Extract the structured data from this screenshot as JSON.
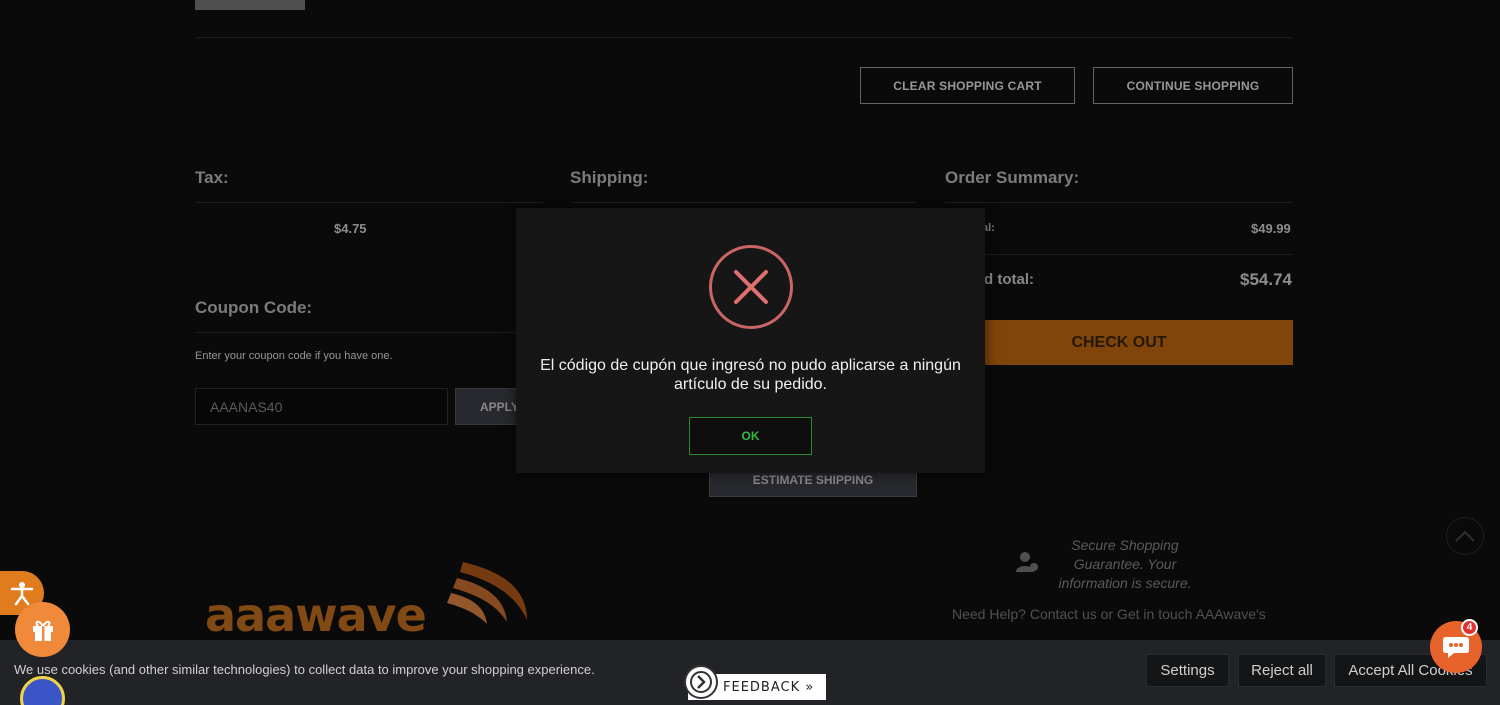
{
  "cart_actions": {
    "clear_label": "CLEAR SHOPPING CART",
    "continue_label": "CONTINUE SHOPPING"
  },
  "tax": {
    "title": "Tax:",
    "value": "$4.75"
  },
  "shipping": {
    "title": "Shipping:",
    "estimate_label": "ESTIMATE SHIPPING"
  },
  "order_summary": {
    "title": "Order Summary:",
    "subtotal_label": "al:",
    "subtotal_value": "$49.99",
    "grand_total_label": "d total:",
    "grand_total_value": "$54.74",
    "checkout_label": "CHECK OUT"
  },
  "coupon": {
    "title": "Coupon Code:",
    "hint": "Enter your coupon code if you have one.",
    "value": "AAANAS40",
    "apply_label": "APPLY"
  },
  "modal": {
    "message": "El código de cupón que ingresó no pudo aplicarse a ningún artículo de su pedido.",
    "ok_label": "OK"
  },
  "footer": {
    "brand": "aaawave",
    "secure_text": "Secure Shopping Guarantee. Your information is secure.",
    "help_text": "Need Help? Contact us or Get in touch AAAwave's"
  },
  "cookie": {
    "text": "We use cookies (and other similar technologies) to collect data to improve your shopping experience.",
    "settings_label": "Settings",
    "reject_label": "Reject all",
    "accept_label": "Accept All Cookies"
  },
  "feedback": {
    "label": "FEEDBACK »"
  },
  "chat": {
    "badge": "4"
  },
  "colors": {
    "accent": "#c46a12",
    "error": "#c96565",
    "ok": "#38b83a"
  }
}
